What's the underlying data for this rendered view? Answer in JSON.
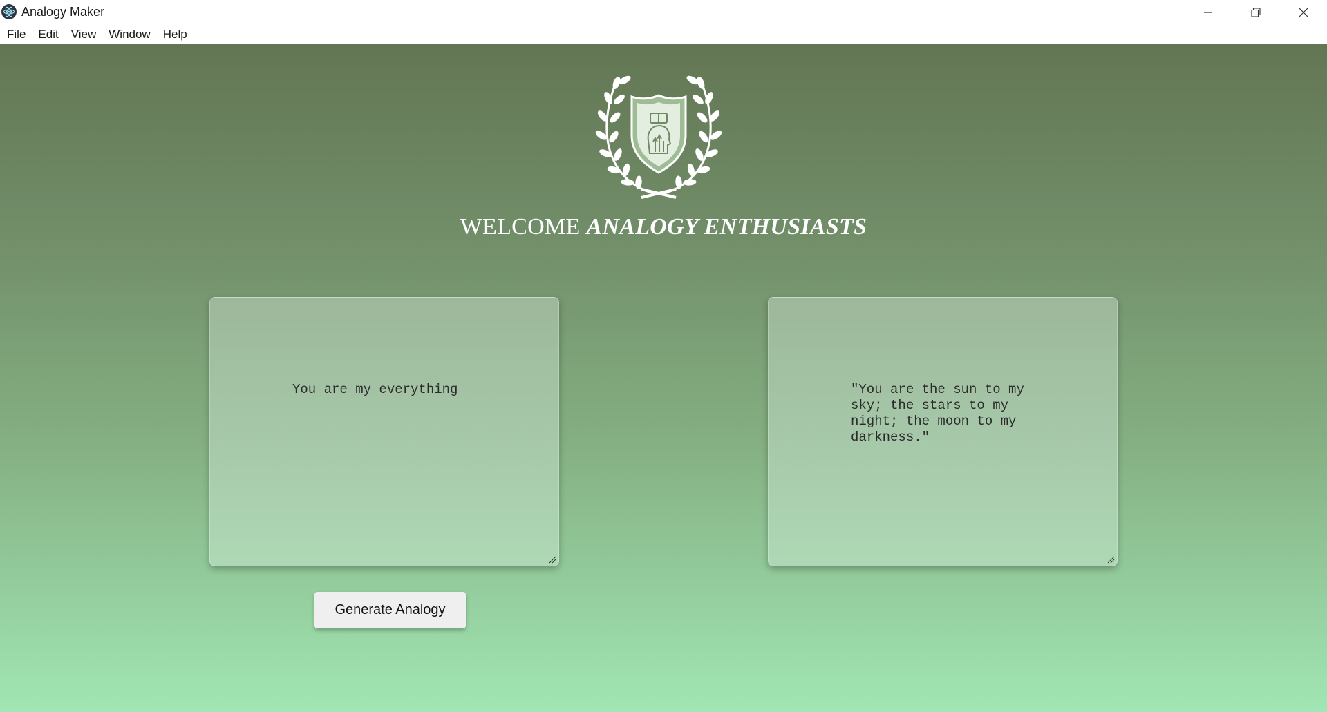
{
  "window": {
    "title": "Analogy Maker",
    "icon": "electron-app-icon",
    "controls": [
      "minimize-icon",
      "restore-icon",
      "close-icon"
    ]
  },
  "menu": [
    "File",
    "Edit",
    "View",
    "Window",
    "Help"
  ],
  "header": {
    "welcome_plain": "WELCOME ",
    "welcome_emphasis": "ANALOGY ENTHUSIASTS",
    "emblem_icon": "laurel-shield-emblem-icon"
  },
  "input": {
    "value": "You are my everything"
  },
  "output": {
    "value": "\"You are the sun to my sky; the stars to my night; the moon to my darkness.\""
  },
  "actions": {
    "generate_label": "Generate Analogy"
  },
  "colors": {
    "gradient_top": "#637654",
    "gradient_bottom": "#a1e6b4",
    "textbox_top": "#9db79b",
    "textbox_bottom": "#aed8b5",
    "button_bg": "#efefef"
  }
}
